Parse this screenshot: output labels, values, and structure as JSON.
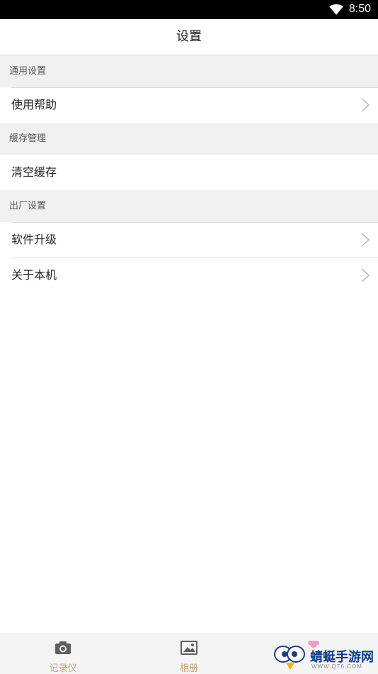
{
  "status_bar": {
    "time": "8:50",
    "wifi_icon": "wifi-icon"
  },
  "header": {
    "title": "设置"
  },
  "sections": [
    {
      "header": "通用设置",
      "items": [
        {
          "label": "使用帮助",
          "has_chevron": true
        }
      ]
    },
    {
      "header": "缓存管理",
      "items": [
        {
          "label": "清空缓存",
          "has_chevron": false
        }
      ]
    },
    {
      "header": "出厂设置",
      "items": [
        {
          "label": "软件升级",
          "has_chevron": true
        },
        {
          "label": "关于本机",
          "has_chevron": true
        }
      ]
    }
  ],
  "bottom_nav": {
    "tabs": [
      {
        "label": "记录仪",
        "icon": "camera-icon"
      },
      {
        "label": "相册",
        "icon": "gallery-icon"
      }
    ]
  },
  "watermark": {
    "text": "蜻蜓手游网",
    "subtext": "WWW.QT6.COM"
  },
  "colors": {
    "section_bg": "#f0f0f0",
    "tab_label": "#c9a87a",
    "status_bar": "#000000"
  }
}
